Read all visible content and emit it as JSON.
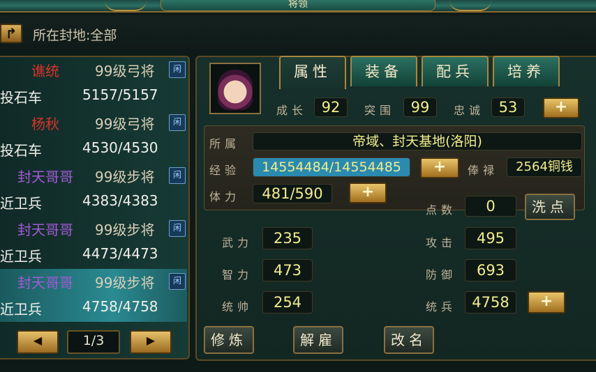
{
  "window": {
    "title": "将领"
  },
  "header": {
    "location_label": "所在封地:全部",
    "back_icon": "back-arrow-icon"
  },
  "generals": [
    {
      "name": "谯统",
      "name_color": "#d8342b",
      "level": "99级弓将",
      "tag": "闲",
      "unit": "投石车",
      "troops": "5157/5157",
      "selected": false
    },
    {
      "name": "杨秋",
      "name_color": "#d8342b",
      "level": "99级弓将",
      "tag": "闲",
      "unit": "投石车",
      "troops": "4530/4530",
      "selected": false
    },
    {
      "name": "封天哥哥",
      "name_color": "#a35ad6",
      "level": "99级步将",
      "tag": "闲",
      "unit": "近卫兵",
      "troops": "4383/4383",
      "selected": false
    },
    {
      "name": "封天哥哥",
      "name_color": "#a35ad6",
      "level": "99级步将",
      "tag": "闲",
      "unit": "近卫兵",
      "troops": "4473/4473",
      "selected": false
    },
    {
      "name": "封天哥哥",
      "name_color": "#a35ad6",
      "level": "99级步将",
      "tag": "闲",
      "unit": "近卫兵",
      "troops": "4758/4758",
      "selected": true
    }
  ],
  "pager": {
    "page": "1/3",
    "prev_icon": "left-triangle-icon",
    "next_icon": "right-triangle-icon"
  },
  "tabs": [
    {
      "label": "属性",
      "active": true
    },
    {
      "label": "装备",
      "active": false
    },
    {
      "label": "配兵",
      "active": false
    },
    {
      "label": "培养",
      "active": false
    }
  ],
  "top_stats": {
    "growth_label": "成长",
    "growth": "92",
    "breakout_label": "突围",
    "breakout": "99",
    "loyalty_label": "忠诚",
    "loyalty": "53"
  },
  "info": {
    "belong_label": "所属",
    "belong": "帝域、封天基地(洛阳)",
    "exp_label": "经验",
    "exp": "14554484/14554485",
    "salary_label": "俸禄",
    "salary": "2564铜钱",
    "stamina_label": "体力",
    "stamina": "481/590"
  },
  "points": {
    "label": "点数",
    "value": "0",
    "wash_button": "洗点"
  },
  "attributes": {
    "force_label": "武力",
    "force": "235",
    "intel_label": "智力",
    "intel": "473",
    "command_label": "统帅",
    "command": "254",
    "attack_label": "攻击",
    "attack": "495",
    "defense_label": "防御",
    "defense": "693",
    "troops_label": "统兵",
    "troops": "4758"
  },
  "actions": {
    "train": "修炼",
    "dismiss": "解雇",
    "rename": "改名"
  },
  "plus_glyph": "+",
  "colors": {
    "value_text": "#f3ee8a",
    "gold_button": "#d9b25a"
  }
}
